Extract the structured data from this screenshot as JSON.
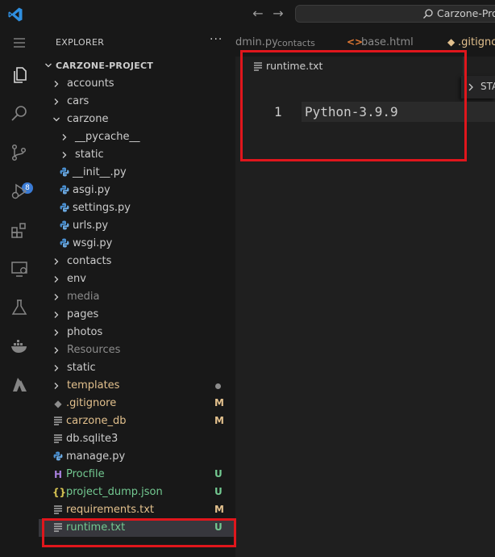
{
  "titlebar": {
    "search_text": "Carzone-Project"
  },
  "activity_badge": "8",
  "sidebar": {
    "title": "EXPLORER",
    "more_actions": "···",
    "project_name": "CARZONE-PROJECT",
    "tree": [
      {
        "label": "accounts",
        "kind": "folder",
        "color": "#cccccc"
      },
      {
        "label": "cars",
        "kind": "folder",
        "color": "#cccccc"
      },
      {
        "label": "carzone",
        "kind": "folder-open",
        "color": "#cccccc"
      },
      {
        "label": "__pycache__",
        "kind": "folder",
        "color": "#cccccc"
      },
      {
        "label": "static",
        "kind": "folder",
        "color": "#cccccc"
      },
      {
        "label": "__init__.py",
        "kind": "python",
        "color": "#cccccc"
      },
      {
        "label": "asgi.py",
        "kind": "python",
        "color": "#cccccc"
      },
      {
        "label": "settings.py",
        "kind": "python",
        "color": "#cccccc"
      },
      {
        "label": "urls.py",
        "kind": "python",
        "color": "#cccccc"
      },
      {
        "label": "wsgi.py",
        "kind": "python",
        "color": "#cccccc"
      },
      {
        "label": "contacts",
        "kind": "folder",
        "color": "#cccccc"
      },
      {
        "label": "env",
        "kind": "folder",
        "color": "#cccccc"
      },
      {
        "label": "media",
        "kind": "folder",
        "color": "#8c8c8c"
      },
      {
        "label": "pages",
        "kind": "folder",
        "color": "#cccccc"
      },
      {
        "label": "photos",
        "kind": "folder",
        "color": "#cccccc"
      },
      {
        "label": "Resources",
        "kind": "folder",
        "color": "#8c8c8c"
      },
      {
        "label": "static",
        "kind": "folder",
        "color": "#cccccc"
      },
      {
        "label": "templates",
        "kind": "folder",
        "color": "#e2c08d"
      },
      {
        "label": ".gitignore",
        "kind": "git",
        "color": "#e2c08d",
        "badge": "M"
      },
      {
        "label": "carzone_db",
        "kind": "text",
        "color": "#e2c08d",
        "badge": "M"
      },
      {
        "label": "db.sqlite3",
        "kind": "text",
        "color": "#cccccc"
      },
      {
        "label": "manage.py",
        "kind": "python",
        "color": "#cccccc"
      },
      {
        "label": "Procfile",
        "kind": "heroku",
        "color": "#73c991",
        "badge": "U"
      },
      {
        "label": "project_dump.json",
        "kind": "json",
        "color": "#73c991",
        "badge": "U"
      },
      {
        "label": "requirements.txt",
        "kind": "text",
        "color": "#e2c08d",
        "badge": "M"
      },
      {
        "label": "runtime.txt",
        "kind": "text",
        "color": "#73c991",
        "badge": "U"
      }
    ]
  },
  "tabs": [
    {
      "label": "dmin.py",
      "desc": "contacts"
    },
    {
      "label": "base.html",
      "desc": ""
    },
    {
      "label": ".gitignore",
      "desc": ""
    }
  ],
  "editor": {
    "breadcrumb": "runtime.txt",
    "line_number": "1",
    "code": "Python-3.9.9",
    "sticky_label": "STA"
  },
  "colors": {
    "accent_highlight": "#e0161c",
    "git_modified": "#e2c08d",
    "git_untracked": "#73c991",
    "badge_blue": "#3a7bd5"
  }
}
